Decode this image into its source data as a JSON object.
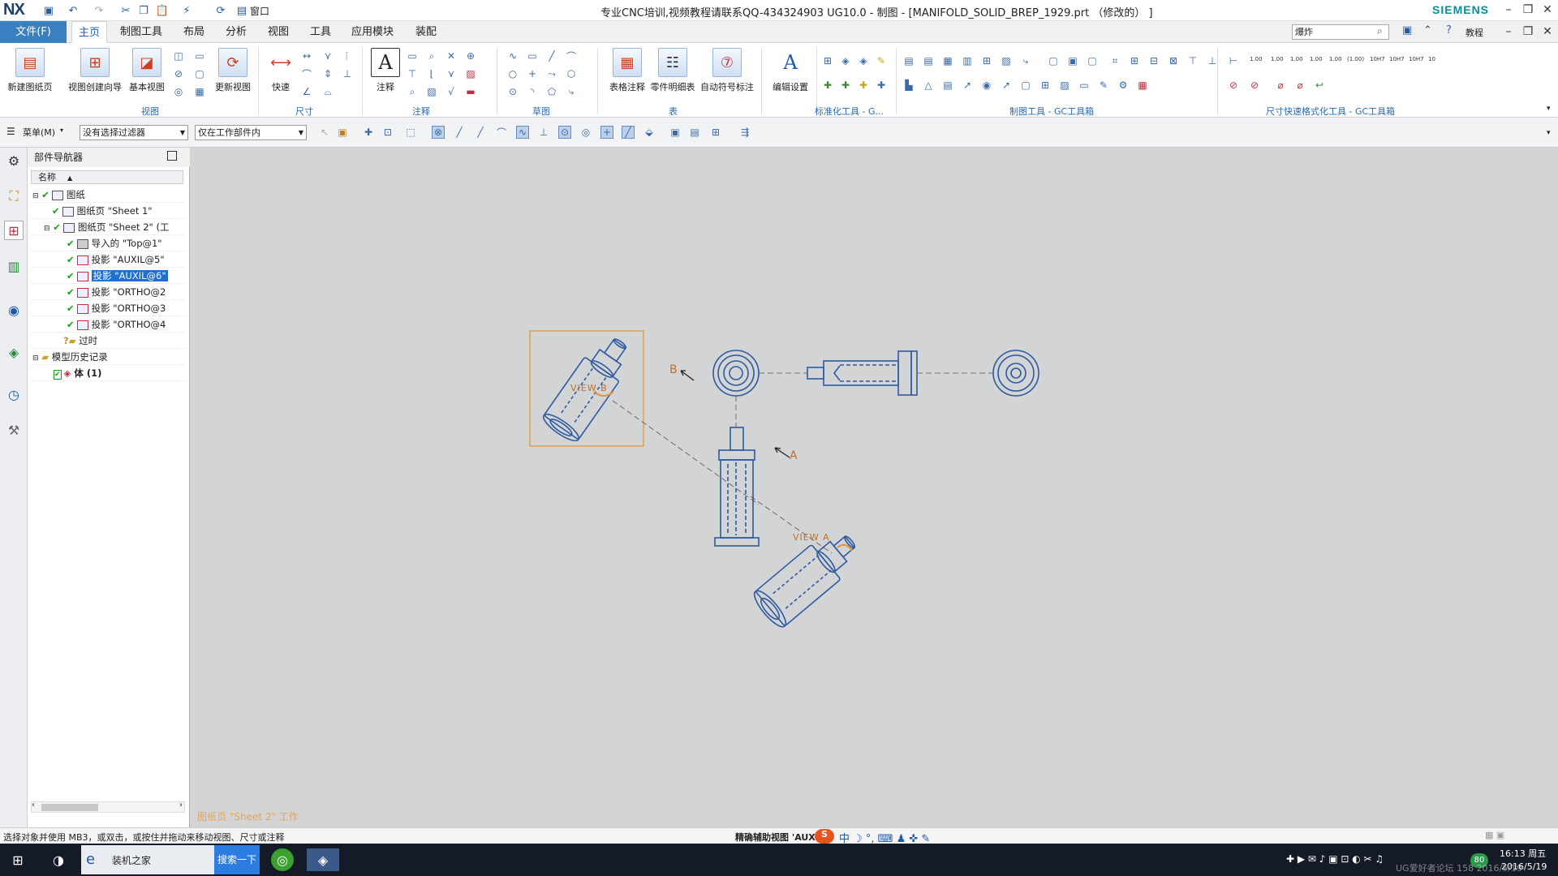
{
  "titlebar": {
    "logo": "NX",
    "window_menu": "窗口",
    "title": "专业CNC培训,视频教程请联系QQ-434324903 UG10.0 - 制图 - [MANIFOLD_SOLID_BREP_1929.prt （修改的） ]",
    "brand": "SIEMENS"
  },
  "menubar": {
    "file": "文件(F)",
    "tabs": [
      "主页",
      "制图工具",
      "布局",
      "分析",
      "视图",
      "工具",
      "应用模块",
      "装配"
    ],
    "search_value": "爆炸",
    "tutorial": "教程"
  },
  "ribbon": {
    "buttons": {
      "new_sheet": "新建图纸页",
      "view_wizard": "视图创建向导",
      "base_view": "基本视图",
      "update_view": "更新视图",
      "quick": "快速",
      "note": "注释",
      "table_note": "表格注释",
      "parts_list": "零件明细表",
      "auto_balloon": "自动符号标注",
      "edit_settings": "编辑设置"
    },
    "groups": {
      "view": "视图",
      "dimension": "尺寸",
      "annotation": "注释",
      "sketch": "草图",
      "table": "表",
      "std_tools": "标准化工具 - G...",
      "drafting_tools": "制图工具 - GC工具箱",
      "dim_format": "尺寸快速格式化工具 - GC工具箱"
    },
    "dim_labels": [
      "1.00",
      "1.00",
      "1.00",
      "1.00",
      "1.00",
      "(1.00)",
      "10H7",
      "10H7",
      "10H7",
      "10"
    ]
  },
  "toolbar2": {
    "menu": "菜单(M)",
    "filter": "没有选择过滤器",
    "scope": "仅在工作部件内"
  },
  "navigator": {
    "title": "部件导航器",
    "column": "名称",
    "items": [
      {
        "label": "图纸"
      },
      {
        "label": "图纸页 \"Sheet 1\""
      },
      {
        "label": "图纸页 \"Sheet 2\" (工"
      },
      {
        "label": "导入的 \"Top@1\""
      },
      {
        "label": "投影 \"AUXIL@5\""
      },
      {
        "label": "投影 \"AUXIL@6\""
      },
      {
        "label": "投影 \"ORTHO@2"
      },
      {
        "label": "投影 \"ORTHO@3"
      },
      {
        "label": "投影 \"ORTHO@4"
      },
      {
        "label": "过时"
      },
      {
        "label": "模型历史记录"
      },
      {
        "label": "体 (1)"
      }
    ]
  },
  "canvas": {
    "view_b_label": "VIEW B",
    "view_a_label": "VIEW A",
    "arrow_b": "B",
    "arrow_a": "A",
    "sheet_label": "图纸页 \"Sheet 2\" 工作"
  },
  "status": {
    "left": "选择对象并使用 MB3，或双击，或按住并拖动来移动视图、尺寸或注释",
    "mid": "精确辅助视图 'AUX"
  },
  "taskbar": {
    "app_name": "装机之家",
    "search_button": "搜索一下",
    "time": "16:13 周五",
    "date": "2016/5/19",
    "watermark": "UG爱好者论坛 158 2016/5/19",
    "badge": "80"
  },
  "colors": {
    "file_tab": "#3a7fbf",
    "selection": "#1e6fd0",
    "drawing_line": "#2d5aa0",
    "highlight": "#e8902a",
    "canvas_bg": "#d3d4d5"
  }
}
